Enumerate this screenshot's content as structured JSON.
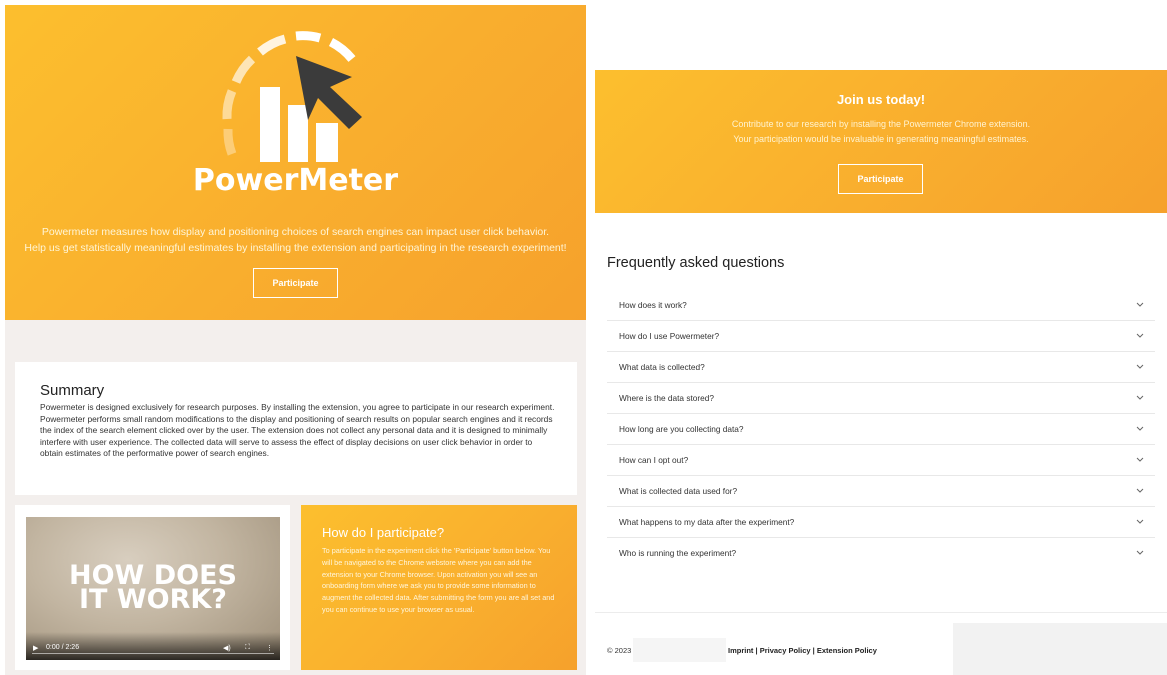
{
  "hero": {
    "brand": "PowerMeter",
    "description_line1": "Powermeter measures how display and positioning choices of search engines can impact user click behavior.",
    "description_line2": "Help us get statistically meaningful estimates by installing the extension and participating in the research experiment!",
    "participate_label": "Participate"
  },
  "summary": {
    "title": "Summary",
    "text": "Powermeter is designed exclusively for research purposes. By installing the extension, you agree to participate in our research experiment. Powermeter performs small random modifications to the display and positioning of search results on popular search engines and it records the index of the search element clicked over by the user. The extension does not collect any personal data and it is designed to minimally interfere with user experience. The collected data will serve to assess the effect of display decisions on user click behavior in order to obtain estimates of the performative power of search engines."
  },
  "video": {
    "title_line1": "HOW DOES",
    "title_line2": "IT WORK?",
    "time": "0:00 / 2:26"
  },
  "how_participate": {
    "title": "How do I participate?",
    "text": "To participate in the experiment click the 'Participate' button below. You will be navigated to the Chrome webstore where you can add the extension to your Chrome browser. Upon activation you will see an onboarding form where we ask you to provide some information to augment the collected data. After submitting the form you are all set and you can continue to use your browser as usual."
  },
  "join": {
    "title": "Join us today!",
    "line1": "Contribute to our research by installing the Powermeter Chrome extension.",
    "line2": "Your participation would be invaluable in generating meaningful estimates.",
    "participate_label": "Participate"
  },
  "faq": {
    "title": "Frequently asked questions",
    "items": [
      "How does it work?",
      "How do I use Powermeter?",
      "What data is collected?",
      "Where is the data stored?",
      "How long are you collecting data?",
      "How can I opt out?",
      "What is collected data used for?",
      "What happens to my data after the experiment?",
      "Who is running the experiment?"
    ]
  },
  "footer": {
    "copyright": "© 2023",
    "imprint": "Imprint",
    "privacy": "Privacy Policy",
    "extension_policy": "Extension Policy",
    "separator": " | "
  },
  "colors": {
    "accent": "#f9ae2e",
    "accent_light": "#fcbf2e",
    "accent_dark": "#f6a12c"
  },
  "icons": [
    "powermeter-logo-icon",
    "cursor-arrow-icon",
    "play-icon",
    "volume-icon",
    "fullscreen-icon",
    "more-icon",
    "chevron-down-icon"
  ]
}
